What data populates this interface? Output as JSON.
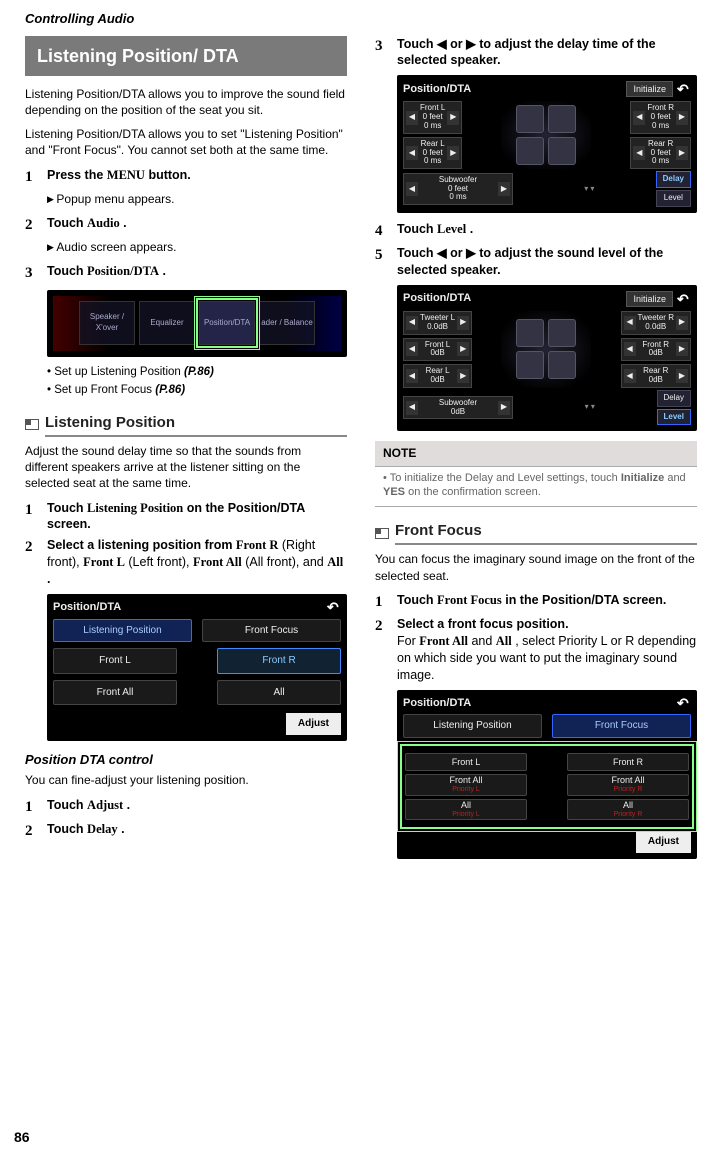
{
  "page": {
    "header": "Controlling Audio",
    "number": "86"
  },
  "section_title": "Listening Position/ DTA",
  "intro1": "Listening Position/DTA allows you to improve the sound field depending on the position of the seat you sit.",
  "intro2": "Listening Position/DTA allows you to set \"Listening Position\" and \"Front Focus\". You cannot set both at the same time.",
  "steps_a": {
    "s1": {
      "n": "1",
      "text_pre": "Press the ",
      "btn": "MENU",
      "text_post": " button.",
      "sub": "Popup menu appears."
    },
    "s2": {
      "n": "2",
      "text_pre": "Touch ",
      "btn": "Audio",
      "text_post": " .",
      "sub": "Audio screen appears."
    },
    "s3": {
      "n": "3",
      "text_pre": "Touch ",
      "btn": "Position/DTA",
      "text_post": " ."
    }
  },
  "eq_items": [
    "Speaker / X'over",
    "Equalizer",
    "Position/DTA",
    "ader / Balance"
  ],
  "bullets_a": [
    {
      "text": "Set up Listening Position ",
      "ref": "(P.86)"
    },
    {
      "text": "Set up Front Focus ",
      "ref": "(P.86)"
    }
  ],
  "subhead1": "Listening Position",
  "lp_intro": "Adjust the sound delay time so that the sounds from different speakers arrive at the listener sitting on the selected seat at the same time.",
  "lp_steps": {
    "s1": {
      "n": "1",
      "pre": "Touch ",
      "btn": "Listening Position",
      "post": " on the Position/DTA screen."
    },
    "s2": {
      "n": "2",
      "pre": "Select a listening position from ",
      "b1": "Front R",
      "t1": " (Right front), ",
      "b2": "Front L",
      "t2": " (Left front), ",
      "b3": "Front All",
      "t3": " (All front), and ",
      "b4": "All",
      "t4": " ."
    }
  },
  "screen_pos": {
    "title": "Position/DTA",
    "tabs": {
      "lp": "Listening Position",
      "ff": "Front Focus"
    },
    "btns": {
      "fl": "Front L",
      "fr": "Front R",
      "fa": "Front All",
      "all": "All"
    },
    "adjust": "Adjust"
  },
  "pdc": {
    "title": "Position DTA control",
    "intro": "You can fine-adjust your listening position.",
    "s1": {
      "n": "1",
      "pre": "Touch ",
      "btn": "Adjust",
      "post": " ."
    },
    "s2": {
      "n": "2",
      "pre": "Touch ",
      "btn": "Delay",
      "post": " ."
    },
    "s3": {
      "n": "3",
      "pre": "Touch ",
      "l": "◀",
      "mid": " or ",
      "r": "▶",
      "post": " to adjust the delay time of the selected speaker."
    },
    "s4": {
      "n": "4",
      "pre": "Touch ",
      "btn": "Level",
      "post": " ."
    },
    "s5": {
      "n": "5",
      "pre": "Touch ",
      "l": "◀",
      "mid": " or ",
      "r": "▶",
      "post": " to adjust the sound level of the selected speaker."
    }
  },
  "screen_delay": {
    "title": "Position/DTA",
    "init": "Initialize",
    "fl": "Front L\n0 feet\n0 ms",
    "fr": "Front R\n0 feet\n0 ms",
    "rl": "Rear L\n0 feet\n0 ms",
    "rr": "Rear R\n0 feet\n0 ms",
    "sub": "Subwoofer\n0 feet\n0 ms",
    "delay": "Delay",
    "level": "Level"
  },
  "screen_level": {
    "title": "Position/DTA",
    "init": "Initialize",
    "tl": "Tweeter L",
    "tlv": "0.0dB",
    "tr": "Tweeter R",
    "trv": "0.0dB",
    "fl": "Front L",
    "flv": "0dB",
    "fr": "Front R",
    "frv": "0dB",
    "rl": "Rear L",
    "rlv": "0dB",
    "rr": "Rear R",
    "rrv": "0dB",
    "sub": "Subwoofer",
    "subv": "0dB",
    "delay": "Delay",
    "level": "Level"
  },
  "note": {
    "title": "NOTE",
    "body_pre": "To initialize the Delay and Level settings, touch ",
    "b1": "Initialize",
    "mid": " and ",
    "b2": "YES",
    "post": " on the confirmation screen."
  },
  "subhead2": "Front Focus",
  "ff_intro": "You can focus the imaginary sound image on the front of the selected seat.",
  "ff_steps": {
    "s1": {
      "n": "1",
      "pre": "Touch ",
      "btn": "Front Focus",
      "post": " in the Position/DTA screen."
    },
    "s2": {
      "n": "2",
      "t1": "Select a front focus position.",
      "t2_pre": "For ",
      "b1": "Front All",
      "t2_mid": " and ",
      "b2": "All",
      "t2_post": " , select Priority L or R depending on which side you want to put the imaginary sound image."
    }
  },
  "screen_ff": {
    "title": "Position/DTA",
    "tabs": {
      "lp": "Listening Position",
      "ff": "Front Focus"
    },
    "fl": "Front L",
    "fr": "Front R",
    "fal": "Front All",
    "fal_p": "Priority L",
    "far": "Front All",
    "far_p": "Priority R",
    "al": "All",
    "al_p": "Priority L",
    "ar": "All",
    "ar_p": "Priority R",
    "adjust": "Adjust"
  }
}
